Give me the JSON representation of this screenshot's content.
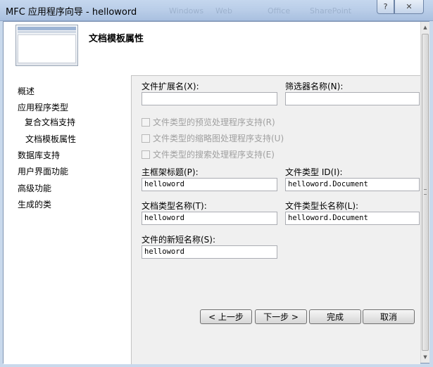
{
  "window": {
    "title": "MFC 应用程序向导 - helloword",
    "background_hints": [
      "Windows",
      "Web",
      "Office",
      "SharePoint"
    ],
    "help_label": "?",
    "close_label": "✕"
  },
  "header": {
    "page_title": "文档模板属性"
  },
  "nav": {
    "items": [
      {
        "label": "概述"
      },
      {
        "label": "应用程序类型"
      },
      {
        "label": "复合文档支持"
      },
      {
        "label": "文档模板属性"
      },
      {
        "label": "数据库支持"
      },
      {
        "label": "用户界面功能"
      },
      {
        "label": "高级功能"
      },
      {
        "label": "生成的类"
      }
    ]
  },
  "form": {
    "file_ext": {
      "label": "文件扩展名(X):",
      "value": ""
    },
    "filter_name": {
      "label": "筛选器名称(N):",
      "value": ""
    },
    "checkboxes": [
      {
        "label": "文件类型的预览处理程序支持(R)",
        "checked": false,
        "enabled": false
      },
      {
        "label": "文件类型的缩略图处理程序支持(U)",
        "checked": false,
        "enabled": false
      },
      {
        "label": "文件类型的搜索处理程序支持(E)",
        "checked": false,
        "enabled": false
      }
    ],
    "main_frame_caption": {
      "label": "主框架标题(P):",
      "value": "helloword"
    },
    "file_type_id": {
      "label": "文件类型 ID(I):",
      "value": "helloword.Document"
    },
    "doc_type_name": {
      "label": "文档类型名称(T):",
      "value": "helloword"
    },
    "file_type_long_name": {
      "label": "文件类型长名称(L):",
      "value": "helloword.Document"
    },
    "file_new_short_name": {
      "label": "文件的新短名称(S):",
      "value": "helloword"
    }
  },
  "buttons": {
    "prev": "< 上一步",
    "next": "下一步 >",
    "finish": "完成",
    "cancel": "取消"
  }
}
